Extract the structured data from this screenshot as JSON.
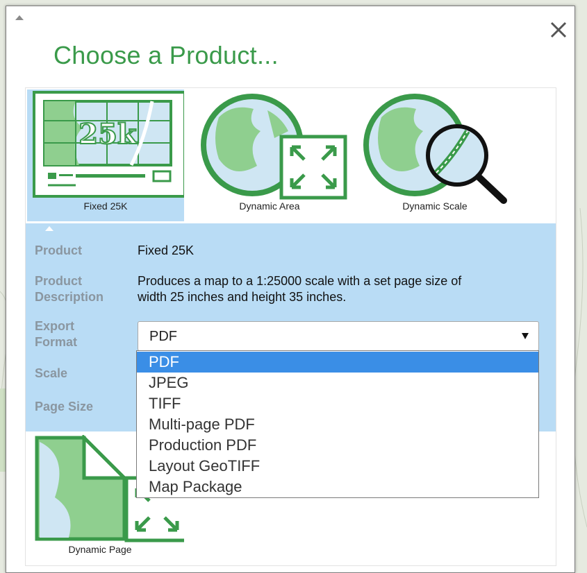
{
  "dialog": {
    "title": "Choose a Product..."
  },
  "products": [
    {
      "label": "Fixed 25K",
      "icon": "fixed-25k-map-icon",
      "badge": "25k",
      "selected": true
    },
    {
      "label": "Dynamic Area",
      "icon": "dynamic-area-globe-icon",
      "selected": false
    },
    {
      "label": "Dynamic Scale",
      "icon": "dynamic-scale-globe-icon",
      "selected": false
    },
    {
      "label": "Dynamic Page",
      "icon": "dynamic-page-icon",
      "selected": false
    }
  ],
  "details": {
    "product_label": "Product",
    "product_value": "Fixed 25K",
    "description_label_1": "Product",
    "description_label_2": "Description",
    "description_line_1": "Produces a map to a 1:25000 scale with a set page size of",
    "description_line_2": "width 25 inches and height 35 inches.",
    "export_label_1": "Export",
    "export_label_2": "Format",
    "scale_label": "Scale",
    "page_size_label": "Page Size"
  },
  "export_format": {
    "selected": "PDF",
    "options": [
      "PDF",
      "JPEG",
      "TIFF",
      "Multi-page PDF",
      "Production PDF",
      "Layout GeoTIFF",
      "Map Package"
    ]
  },
  "colors": {
    "accent_green": "#3a9a4a",
    "selection_blue": "#b9dcf5",
    "highlight_blue": "#3a8ee6"
  }
}
